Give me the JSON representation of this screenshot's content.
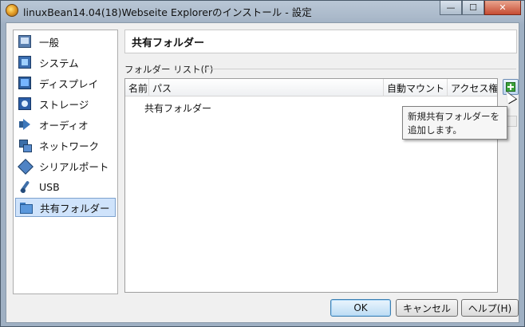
{
  "window": {
    "title": "linuxBean14.04(18)Webseite Explorerのインストール - 設定",
    "minimize_glyph": "—",
    "maximize_glyph": "☐",
    "close_glyph": "✕"
  },
  "sidebar": {
    "items": [
      {
        "label": "一般",
        "icon": "general-icon"
      },
      {
        "label": "システム",
        "icon": "system-icon"
      },
      {
        "label": "ディスプレイ",
        "icon": "display-icon"
      },
      {
        "label": "ストレージ",
        "icon": "storage-icon"
      },
      {
        "label": "オーディオ",
        "icon": "audio-icon"
      },
      {
        "label": "ネットワーク",
        "icon": "network-icon"
      },
      {
        "label": "シリアルポート",
        "icon": "serial-port-icon"
      },
      {
        "label": "USB",
        "icon": "usb-icon"
      },
      {
        "label": "共有フォルダー",
        "icon": "shared-folder-icon",
        "selected": true
      }
    ]
  },
  "main": {
    "page_title": "共有フォルダー",
    "group_label": "フォルダー リスト(F)",
    "table": {
      "columns": [
        "名前",
        "パス",
        "自動マウント",
        "アクセス権"
      ],
      "rows": [
        {
          "name": "共有フォルダー"
        }
      ]
    },
    "tooltip": {
      "line1": "新規共有フォルダーを",
      "line2": "追加します。"
    }
  },
  "buttons": {
    "ok": "OK",
    "cancel": "キャンセル",
    "help": "ヘルプ(H)"
  }
}
